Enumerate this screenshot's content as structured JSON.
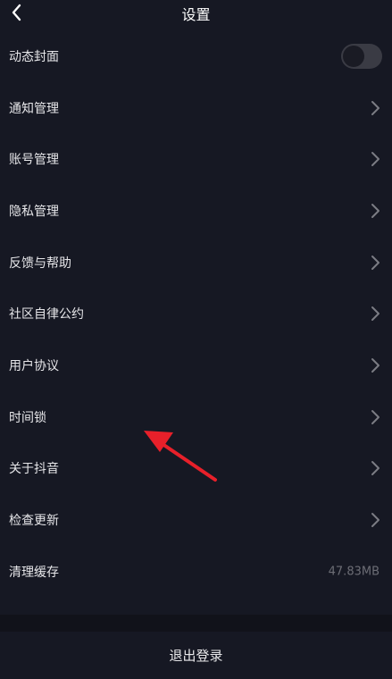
{
  "header": {
    "title": "设置",
    "back_icon": "chevron-left-icon"
  },
  "settings": {
    "items": [
      {
        "label": "动态封面",
        "control": "toggle",
        "toggle_on": false
      },
      {
        "label": "通知管理",
        "control": "chevron"
      },
      {
        "label": "账号管理",
        "control": "chevron"
      },
      {
        "label": "隐私管理",
        "control": "chevron"
      },
      {
        "label": "反馈与帮助",
        "control": "chevron"
      },
      {
        "label": "社区自律公约",
        "control": "chevron"
      },
      {
        "label": "用户协议",
        "control": "chevron"
      },
      {
        "label": "时间锁",
        "control": "chevron"
      },
      {
        "label": "关于抖音",
        "control": "chevron"
      },
      {
        "label": "检查更新",
        "control": "chevron"
      },
      {
        "label": "清理缓存",
        "control": "value",
        "value": "47.83MB"
      }
    ]
  },
  "footer": {
    "logout_label": "退出登录"
  },
  "colors": {
    "background": "#161823",
    "section_gap": "#11121a",
    "annotation_arrow": "#e8202a"
  }
}
